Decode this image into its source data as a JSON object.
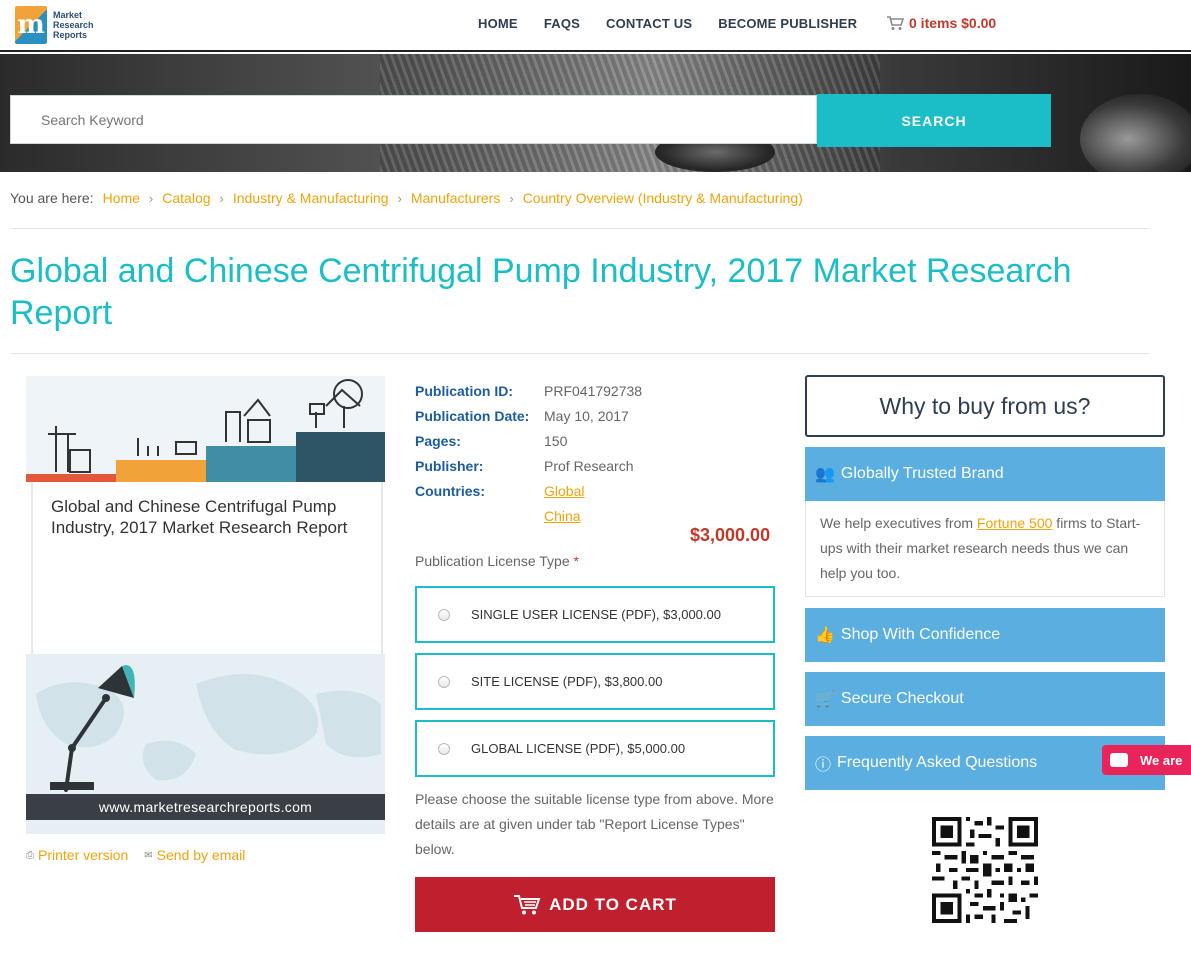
{
  "header": {
    "logo_lines": [
      "Market",
      "Research",
      "Reports"
    ],
    "logo_letter": "m",
    "nav": [
      "HOME",
      "FAQS",
      "CONTACT US",
      "BECOME PUBLISHER"
    ],
    "cart_label": "0 items $0.00"
  },
  "search": {
    "placeholder": "Search Keyword",
    "button_label": "SEARCH"
  },
  "breadcrumb": {
    "label": "You are here:",
    "items": [
      "Home",
      "Catalog",
      "Industry & Manufacturing",
      "Manufacturers",
      "Country Overview (Industry & Manufacturing)"
    ]
  },
  "page_title": "Global and Chinese Centrifugal Pump Industry, 2017 Market Research Report",
  "cover": {
    "title": "Global and Chinese Centrifugal Pump Industry, 2017 Market Research Report",
    "url": "www.marketresearchreports.com"
  },
  "links": {
    "printer": "Printer version",
    "email": "Send by email"
  },
  "details": {
    "pub_id_label": "Publication ID:",
    "pub_id": "PRF041792738",
    "pub_date_label": "Publication Date:",
    "pub_date": "May 10, 2017",
    "pages_label": "Pages:",
    "pages": "150",
    "publisher_label": "Publisher:",
    "publisher": "Prof Research",
    "countries_label": "Countries:",
    "countries": [
      "Global",
      "China"
    ]
  },
  "price": "$3,000.00",
  "license": {
    "label": "Publication License Type",
    "required_mark": "*",
    "options": [
      "SINGLE USER LICENSE (PDF), $3,000.00",
      "SITE LICENSE (PDF), $3,800.00",
      "GLOBAL LICENSE (PDF), $5,000.00"
    ],
    "help": "Please choose the suitable license type from above. More details are at given under tab \"Report License Types\" below."
  },
  "add_to_cart": "ADD TO CART",
  "sidebar": {
    "why": "Why to buy from us?",
    "trusted": "Globally Trusted Brand",
    "trusted_body_pre": "We help executives from ",
    "trusted_body_link": "Fortune 500",
    "trusted_body_post": " firms to Start-ups with their market research needs thus we can help you too.",
    "confidence": "Shop With Confidence",
    "checkout": "Secure Checkout",
    "faq": "Frequently Asked Questions"
  },
  "chat_label": "We are",
  "colors": {
    "accent": "#1bbec6",
    "link": "#f0a30a",
    "price": "#c0392b",
    "cart_button": "#c0202d",
    "panel": "#5aafe0"
  }
}
